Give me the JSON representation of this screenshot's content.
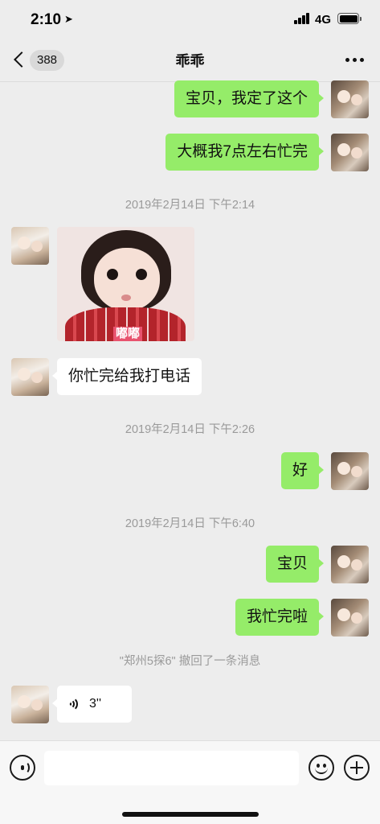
{
  "status_bar": {
    "time": "2:10",
    "network": "4G"
  },
  "nav": {
    "unread_count": "388",
    "title": "乖乖"
  },
  "messages": [
    {
      "sender": "me",
      "text": "宝贝，我定了这个"
    },
    {
      "sender": "me",
      "text": "大概我7点左右忙完"
    },
    {
      "type": "timestamp",
      "text": "2019年2月14日 下午2:14"
    },
    {
      "sender": "them",
      "type": "sticker",
      "caption": "嘟嘟"
    },
    {
      "sender": "them",
      "text": "你忙完给我打电话"
    },
    {
      "type": "timestamp",
      "text": "2019年2月14日 下午2:26"
    },
    {
      "sender": "me",
      "text": "好"
    },
    {
      "type": "timestamp",
      "text": "2019年2月14日 下午6:40"
    },
    {
      "sender": "me",
      "text": "宝贝"
    },
    {
      "sender": "me",
      "text": "我忙完啦"
    },
    {
      "type": "system",
      "text": "\"郑州5探6\" 撤回了一条消息"
    },
    {
      "sender": "them",
      "type": "voice",
      "duration": "3''"
    }
  ],
  "input_bar": {
    "text": ""
  },
  "colors": {
    "background": "#ededed",
    "my_bubble": "#95ec69",
    "their_bubble": "#ffffff",
    "timestamp": "#9a9a9a"
  }
}
